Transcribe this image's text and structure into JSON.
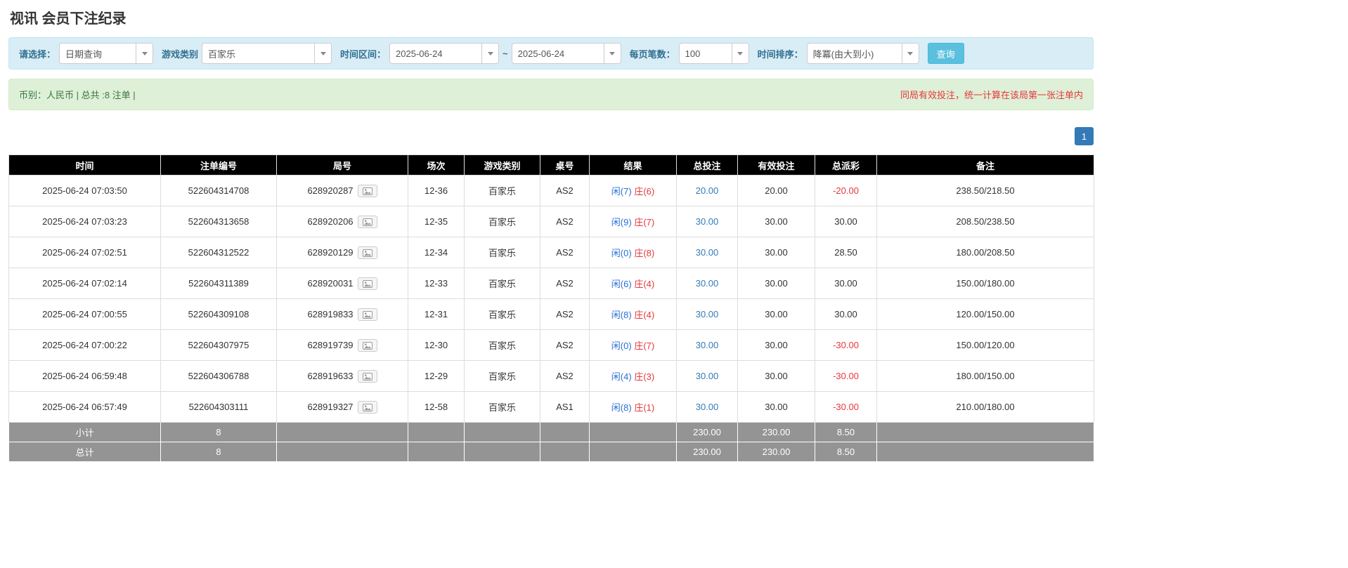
{
  "page": {
    "title": "视讯 会员下注纪录"
  },
  "filters": {
    "select_label": "请选择：",
    "select_value": "日期查询",
    "game_type_label": "游戏类别",
    "game_type_value": "百家乐",
    "time_range_label": "时间区间：",
    "date_from": "2025-06-24",
    "tilde": "~",
    "date_to": "2025-06-24",
    "page_size_label": "每页笔数：",
    "page_size_value": "100",
    "sort_label": "时间排序：",
    "sort_value": "降冪(由大到小)",
    "search_button": "查询"
  },
  "summary": {
    "left": "币别：人民币 | 总共 :8 注单 |",
    "right": "同局有效投注，统一计算在该局第一张注单内"
  },
  "pagination": {
    "current_page": "1"
  },
  "icons": {
    "dropdown_caret": "chevron-down",
    "round_detail": "photo-icon"
  },
  "colors": {
    "header_bg": "#000000",
    "footer_bg": "#949494",
    "filter_bg": "#d9edf7",
    "summary_bg": "#dff0d8",
    "summary_text": "#3c763d",
    "warning_text": "#e4393c",
    "link_blue": "#337ab7",
    "player_blue": "#2a6fd4",
    "banker_red": "#e4393c",
    "negative_red": "#e4393c",
    "search_button_bg": "#5bc0de",
    "pagination_bg": "#337ab7"
  },
  "table": {
    "headers": [
      "时间",
      "注单编号",
      "局号",
      "场次",
      "游戏类别",
      "桌号",
      "结果",
      "总投注",
      "有效投注",
      "总派彩",
      "备注"
    ],
    "rows": [
      {
        "time": "2025-06-24 07:03:50",
        "bet_id": "522604314708",
        "round_id": "628920287",
        "session": "12-36",
        "game": "百家乐",
        "table_no": "AS2",
        "player": "闲(7)",
        "banker": "庄(6)",
        "total_bet": "20.00",
        "valid_bet": "20.00",
        "payout": "-20.00",
        "remark": "238.50/218.50"
      },
      {
        "time": "2025-06-24 07:03:23",
        "bet_id": "522604313658",
        "round_id": "628920206",
        "session": "12-35",
        "game": "百家乐",
        "table_no": "AS2",
        "player": "闲(9)",
        "banker": "庄(7)",
        "total_bet": "30.00",
        "valid_bet": "30.00",
        "payout": "30.00",
        "remark": "208.50/238.50"
      },
      {
        "time": "2025-06-24 07:02:51",
        "bet_id": "522604312522",
        "round_id": "628920129",
        "session": "12-34",
        "game": "百家乐",
        "table_no": "AS2",
        "player": "闲(0)",
        "banker": "庄(8)",
        "total_bet": "30.00",
        "valid_bet": "30.00",
        "payout": "28.50",
        "remark": "180.00/208.50"
      },
      {
        "time": "2025-06-24 07:02:14",
        "bet_id": "522604311389",
        "round_id": "628920031",
        "session": "12-33",
        "game": "百家乐",
        "table_no": "AS2",
        "player": "闲(6)",
        "banker": "庄(4)",
        "total_bet": "30.00",
        "valid_bet": "30.00",
        "payout": "30.00",
        "remark": "150.00/180.00"
      },
      {
        "time": "2025-06-24 07:00:55",
        "bet_id": "522604309108",
        "round_id": "628919833",
        "session": "12-31",
        "game": "百家乐",
        "table_no": "AS2",
        "player": "闲(8)",
        "banker": "庄(4)",
        "total_bet": "30.00",
        "valid_bet": "30.00",
        "payout": "30.00",
        "remark": "120.00/150.00"
      },
      {
        "time": "2025-06-24 07:00:22",
        "bet_id": "522604307975",
        "round_id": "628919739",
        "session": "12-30",
        "game": "百家乐",
        "table_no": "AS2",
        "player": "闲(0)",
        "banker": "庄(7)",
        "total_bet": "30.00",
        "valid_bet": "30.00",
        "payout": "-30.00",
        "remark": "150.00/120.00"
      },
      {
        "time": "2025-06-24 06:59:48",
        "bet_id": "522604306788",
        "round_id": "628919633",
        "session": "12-29",
        "game": "百家乐",
        "table_no": "AS2",
        "player": "闲(4)",
        "banker": "庄(3)",
        "total_bet": "30.00",
        "valid_bet": "30.00",
        "payout": "-30.00",
        "remark": "180.00/150.00"
      },
      {
        "time": "2025-06-24 06:57:49",
        "bet_id": "522604303111",
        "round_id": "628919327",
        "session": "12-58",
        "game": "百家乐",
        "table_no": "AS1",
        "player": "闲(8)",
        "banker": "庄(1)",
        "total_bet": "30.00",
        "valid_bet": "30.00",
        "payout": "-30.00",
        "remark": "210.00/180.00"
      }
    ],
    "subtotal": {
      "label": "小计",
      "count": "8",
      "total_bet": "230.00",
      "valid_bet": "230.00",
      "payout": "8.50"
    },
    "total": {
      "label": "总计",
      "count": "8",
      "total_bet": "230.00",
      "valid_bet": "230.00",
      "payout": "8.50"
    }
  }
}
